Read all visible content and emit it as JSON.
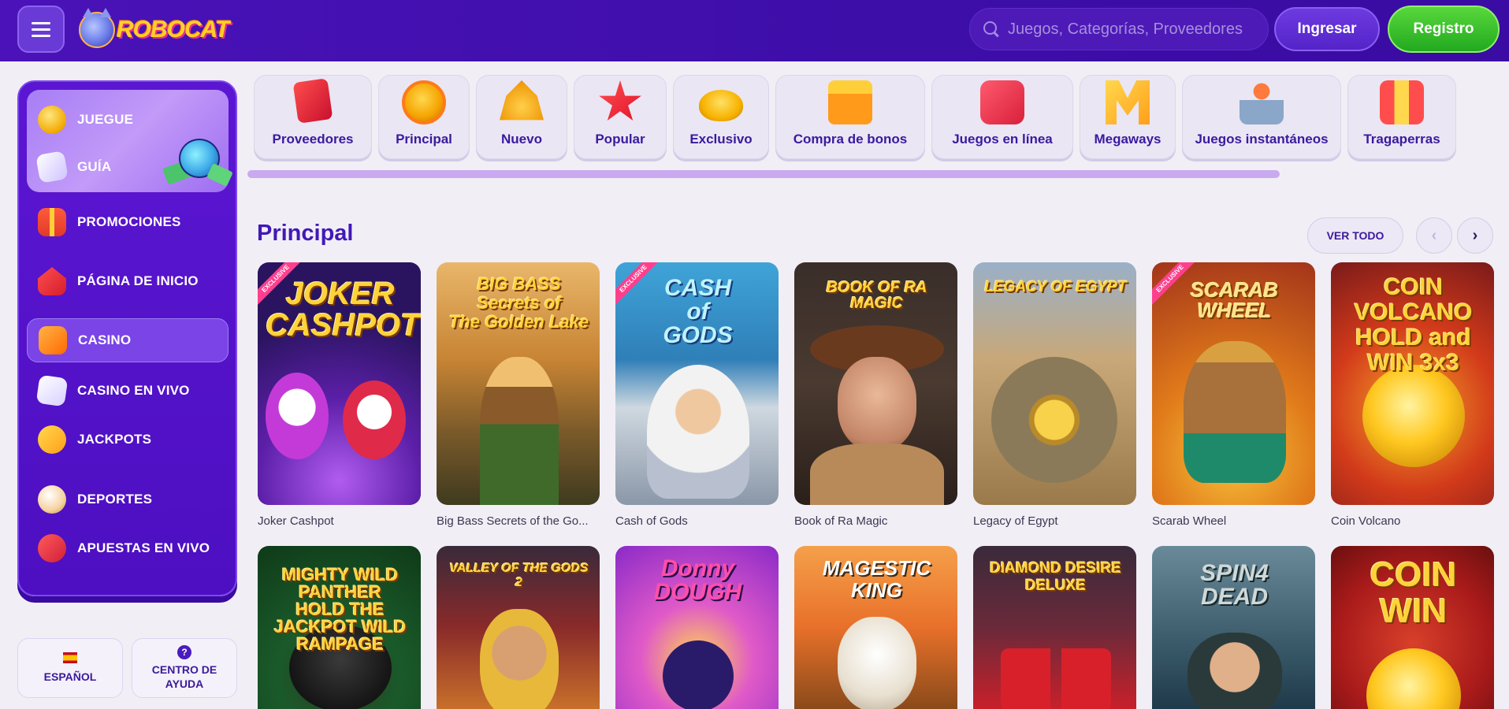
{
  "header": {
    "logo_text": "ROBOCAT",
    "search_placeholder": "Juegos, Categorías, Proveedores",
    "login_label": "Ingresar",
    "register_label": "Registro"
  },
  "sidebar": {
    "items": [
      {
        "label": "JUEGUE",
        "icon": "coin-icon"
      },
      {
        "label": "GUÍA",
        "icon": "guide-icon"
      },
      {
        "label": "PROMOCIONES",
        "icon": "gift-icon"
      },
      {
        "label": "PÁGINA DE INICIO",
        "icon": "home-icon"
      },
      {
        "label": "CASINO",
        "icon": "slot-icon",
        "active": true
      },
      {
        "label": "CASINO EN VIVO",
        "icon": "cards-icon"
      },
      {
        "label": "JACKPOTS",
        "icon": "seven-icon"
      },
      {
        "label": "DEPORTES",
        "icon": "ball-icon"
      },
      {
        "label": "APUESTAS EN VIVO",
        "icon": "live-icon"
      }
    ],
    "language_label": "ESPAÑOL",
    "help_label_1": "CENTRO DE",
    "help_label_2": "AYUDA",
    "help_glyph": "?"
  },
  "categories": [
    {
      "label": "Proveedores",
      "icon": "providers-icon"
    },
    {
      "label": "Principal",
      "icon": "medal-icon"
    },
    {
      "label": "Nuevo",
      "icon": "bell-icon"
    },
    {
      "label": "Popular",
      "icon": "star-icon"
    },
    {
      "label": "Exclusivo",
      "icon": "gold-icon"
    },
    {
      "label": "Compra de bonos",
      "icon": "gift-box-icon"
    },
    {
      "label": "Juegos en línea",
      "icon": "play-icon"
    },
    {
      "label": "Megaways",
      "icon": "megaways-icon"
    },
    {
      "label": "Juegos instantáneos",
      "icon": "joystick-icon"
    },
    {
      "label": "Tragaperras",
      "icon": "slot-machine-icon"
    }
  ],
  "section": {
    "title": "Principal",
    "see_all": "VER TODO",
    "prev": "‹",
    "next": "›"
  },
  "games_row1": [
    {
      "name": "Joker Cashpot",
      "art": "JOKER\nCASHPOT",
      "exclusive": true
    },
    {
      "name": "Big Bass Secrets of the Go...",
      "art": "BIG BASS\nSecrets of\nThe Golden Lake",
      "exclusive": false
    },
    {
      "name": "Cash of Gods",
      "art": "CASH\nof\nGODS",
      "exclusive": true
    },
    {
      "name": "Book of Ra Magic",
      "art": "BOOK OF RA\nMAGIC",
      "exclusive": false
    },
    {
      "name": "Legacy of Egypt",
      "art": "LEGACY OF EGYPT",
      "exclusive": false
    },
    {
      "name": "Scarab Wheel",
      "art": "SCARAB\nWHEEL",
      "exclusive": true
    },
    {
      "name": "Coin Volcano",
      "art": "COIN\nVOLCANO\nHOLD and WIN 3x3",
      "exclusive": false
    }
  ],
  "games_row2": [
    {
      "art": "MIGHTY WILD\nPANTHER\nHOLD THE JACKPOT WILD RAMPAGE"
    },
    {
      "art": "VALLEY OF THE GODS 2"
    },
    {
      "art": "Donny\nDOUGH"
    },
    {
      "art": "MAGESTIC\nKING"
    },
    {
      "art": "DIAMOND DESIRE\nDELUXE"
    },
    {
      "art": "SPIN4\nDEAD"
    },
    {
      "art": "COIN\nWIN"
    }
  ],
  "exclusive_badge": "EXCLUSIVE"
}
